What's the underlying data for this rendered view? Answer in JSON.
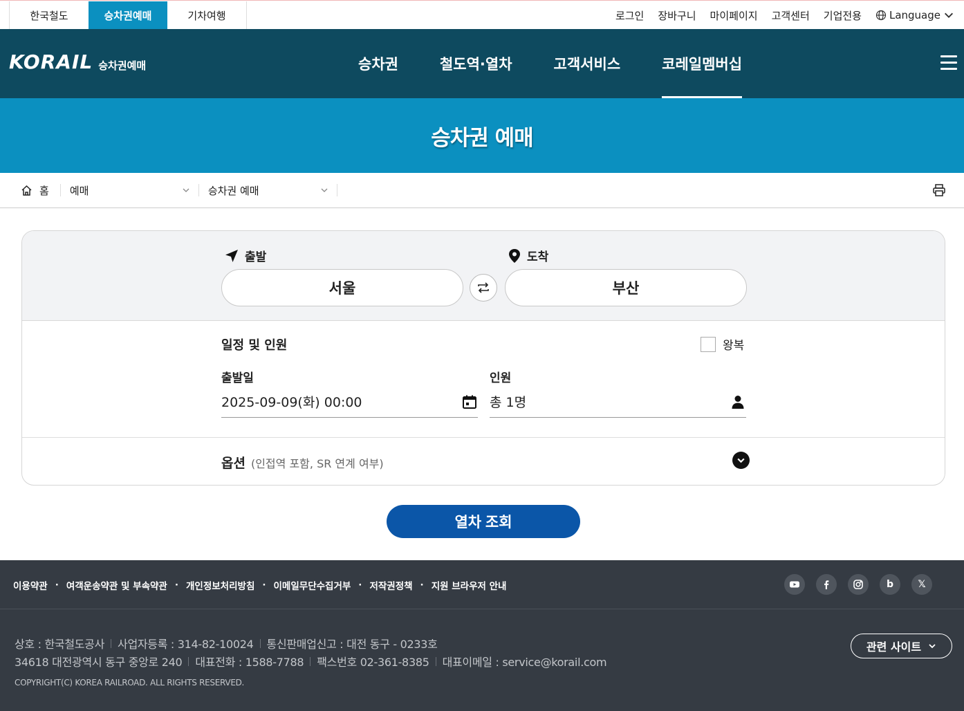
{
  "topbar": {
    "tabs": [
      "한국철도",
      "승차권예매",
      "기차여행"
    ],
    "util": {
      "login": "로그인",
      "cart": "장바구니",
      "mypage": "마이페이지",
      "support": "고객센터",
      "corporate": "기업전용",
      "language": "Language"
    }
  },
  "nav": {
    "logo_word": "KORAIL",
    "logo_sub": "승차권예매",
    "items": [
      "승차권",
      "철도역·열차",
      "고객서비스",
      "코레일멤버십"
    ]
  },
  "banner": {
    "title": "승차권 예매"
  },
  "breadcrumb": {
    "home": "홈",
    "level1": "예매",
    "level2": "승차권 예매"
  },
  "search": {
    "departure_label": "출발",
    "arrival_label": "도착",
    "departure": "서울",
    "arrival": "부산",
    "schedule_title": "일정 및 인원",
    "roundtrip_label": "왕복",
    "date_label": "출발일",
    "date_value": "2025-09-09(화) 00:00",
    "pax_label": "인원",
    "pax_value": "총 1명",
    "options_label": "옵션",
    "options_hint": "(인접역 포함, SR 연계 여부)",
    "submit": "열차 조회"
  },
  "footer": {
    "links": [
      "이용약관",
      "여객운송약관 및 부속약관",
      "개인정보처리방침",
      "이메일무단수집거부",
      "저작권정책",
      "지원 브라우저 안내"
    ],
    "info_line1": [
      "상호 : 한국철도공사",
      "사업자등록 : 314-82-10024",
      "통신판매업신고 : 대전 동구 - 0233호"
    ],
    "info_line2": [
      "34618 대전광역시 동구 중앙로 240",
      "대표전화 : 1588-7788",
      "팩스번호 02-361-8385",
      "대표이메일 : service@korail.com"
    ],
    "copyright": "COPYRIGHT(C) KOREA RAILROAD. ALL RIGHTS RESERVED.",
    "related": "관련 사이트",
    "social_blog_letter": "b",
    "social_x_letter": "𝕏"
  },
  "colors": {
    "nav_bg": "#0e4a5f",
    "accent": "#0b90c0",
    "button": "#0b56a8",
    "footer_bg": "#353b43"
  }
}
